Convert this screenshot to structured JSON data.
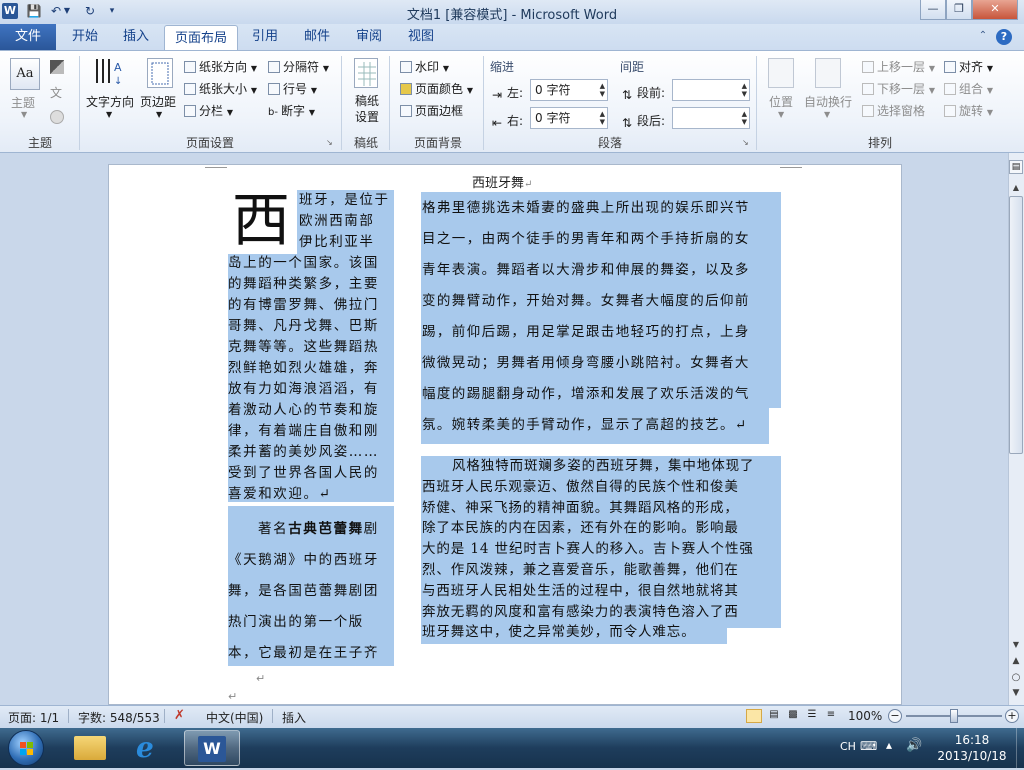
{
  "window": {
    "title": "文档1 [兼容模式] - Microsoft Word",
    "app_icon": "W"
  },
  "qat": {
    "save": "save-icon",
    "undo": "undo-icon",
    "redo": "redo-icon",
    "customize": "customize-icon"
  },
  "ribbon_tabs": [
    {
      "label": "文件"
    },
    {
      "label": "开始"
    },
    {
      "label": "插入"
    },
    {
      "label": "页面布局"
    },
    {
      "label": "引用"
    },
    {
      "label": "邮件"
    },
    {
      "label": "审阅"
    },
    {
      "label": "视图"
    }
  ],
  "ribbon": {
    "themes": {
      "label": "主题",
      "btn": "主题"
    },
    "page_setup": {
      "label": "页面设置",
      "text_direction": "文字方向",
      "margins": "页边距",
      "orientation": "纸张方向",
      "size": "纸张大小",
      "columns": "分栏",
      "breaks": "分隔符",
      "line_numbers": "行号",
      "hyphenation": "断字"
    },
    "manuscript": {
      "label": "稿纸",
      "btn": "稿纸设置"
    },
    "page_background": {
      "label": "页面背景",
      "watermark": "水印",
      "page_color": "页面颜色",
      "page_borders": "页面边框"
    },
    "paragraph": {
      "label": "段落",
      "indent_title": "缩进",
      "spacing_title": "间距",
      "left_label": "左:",
      "left_value": "0 字符",
      "right_label": "右:",
      "right_value": "0 字符",
      "before_label": "段前:",
      "before_value": "",
      "after_label": "段后:",
      "after_value": ""
    },
    "arrange": {
      "label": "排列",
      "position": "位置",
      "wrap": "自动换行",
      "bring_forward": "上移一层",
      "send_backward": "下移一层",
      "selection_pane": "选择窗格",
      "align": "对齐",
      "group": "组合",
      "rotate": "旋转"
    }
  },
  "document": {
    "title": "西班牙舞",
    "dropcap": "西",
    "left_col": [
      "班牙，是位于",
      "欧洲西南部",
      "伊比利亚半",
      "岛上的一个国家。该国",
      "的舞蹈种类繁多，主要",
      "的有博雷罗舞、佛拉门",
      "哥舞、凡丹戈舞、巴斯",
      "克舞等等。这些舞蹈热",
      "烈鲜艳如烈火雄雄，奔",
      "放有力如海浪滔滔，有",
      "着激动人心的节奏和旋",
      "律，有着端庄自傲和刚",
      "柔并蓄的美妙风姿……",
      "受到了世界各国人民的",
      "喜爱和欢迎。↵"
    ],
    "left_col2_intro": "著名",
    "left_col2_bold": "古典芭蕾舞",
    "left_col2": [
      "剧",
      "《天鹅湖》中的西班牙",
      "舞，是各国芭蕾舞剧团",
      "热门演出的第一个版",
      "本，它最初是在王子齐"
    ],
    "right_col": [
      "格弗里德挑选未婚妻的盛典上所出现的娱乐即兴节",
      "目之一，由两个徒手的男青年和两个手持折扇的女",
      "青年表演。舞蹈者以大滑步和伸展的舞姿，以及多",
      "变的舞臂动作，开始对舞。女舞者大幅度的后仰前",
      "踢，前仰后踢，用足掌足跟击地轻巧的打点，上身",
      "微微晃动；男舞者用倾身弯腰小跳陪衬。女舞者大",
      "幅度的踢腿翻身动作，增添和发展了欢乐活泼的气",
      "氛。婉转柔美的手臂动作，显示了高超的技艺。↵"
    ],
    "right_col2": [
      "风格独特而斑斓多姿的西班牙舞，集中地体现了",
      "西班牙人民乐观豪迈、傲然自得的民族个性和俊美",
      "矫健、神采飞扬的精神面貌。其舞蹈风格的形成，",
      "除了本民族的内在因素，还有外在的影响。影响最",
      "大的是 14 世纪时吉卜赛人的移入。吉卜赛人个性强",
      "烈、作风泼辣，兼之喜爱音乐，能歌善舞，他们在",
      "与西班牙人民相处生活的过程中，很自然地就将其",
      "奔放无羁的风度和富有感染力的表演特色溶入了西",
      "班牙舞这中，使之异常美妙，而令人难忘。"
    ],
    "end_marks": [
      "↵",
      "↵"
    ]
  },
  "status": {
    "page": "页面: 1/1",
    "words": "字数: 548/553",
    "lang": "中文(中国)",
    "mode": "插入",
    "zoom": "100%"
  },
  "taskbar": {
    "ime": "CH",
    "time": "16:18",
    "date": "2013/10/18"
  }
}
